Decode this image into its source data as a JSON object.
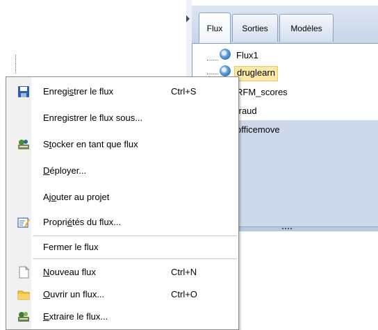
{
  "tabs": [
    {
      "label": "Flux",
      "active": true
    },
    {
      "label": "Sorties",
      "active": false
    },
    {
      "label": "Modèles",
      "active": false
    }
  ],
  "streams": [
    {
      "name": "Flux1",
      "selected": false
    },
    {
      "name": "druglearn",
      "selected": true
    },
    {
      "name": "RFM_scores",
      "selected": false
    },
    {
      "name": "fraud",
      "selected": false
    },
    {
      "name": "officemove",
      "selected": false
    }
  ],
  "menu": {
    "items": [
      {
        "pre": "Enregi",
        "u": "s",
        "post": "trer le flux",
        "shortcut": "Ctrl+S",
        "icon": "save-icon"
      },
      {
        "pre": "Enregistrer le flux sous...",
        "u": "",
        "post": "",
        "shortcut": "",
        "icon": ""
      },
      {
        "pre": "S",
        "u": "t",
        "post": "ocker en tant que flux",
        "shortcut": "",
        "icon": "store-stream-icon"
      },
      {
        "pre": "",
        "u": "D",
        "post": "éployer...",
        "shortcut": "",
        "icon": ""
      },
      {
        "pre": "Aj",
        "u": "o",
        "post": "uter au projet",
        "shortcut": "",
        "icon": ""
      },
      {
        "pre": "Propri",
        "u": "é",
        "post": "tés du flux...",
        "shortcut": "",
        "icon": "properties-icon"
      },
      {
        "pre": "Fermer le flux",
        "u": "",
        "post": "",
        "shortcut": "",
        "icon": ""
      },
      {
        "pre": "",
        "u": "N",
        "post": "ouveau flux",
        "shortcut": "Ctrl+N",
        "icon": "new-stream-icon"
      },
      {
        "pre": "",
        "u": "O",
        "post": "uvrir un flux...",
        "shortcut": "Ctrl+O",
        "icon": "open-folder-icon"
      },
      {
        "pre": "",
        "u": "E",
        "post": "xtraire le flux...",
        "shortcut": "",
        "icon": "extract-stream-icon"
      }
    ]
  }
}
